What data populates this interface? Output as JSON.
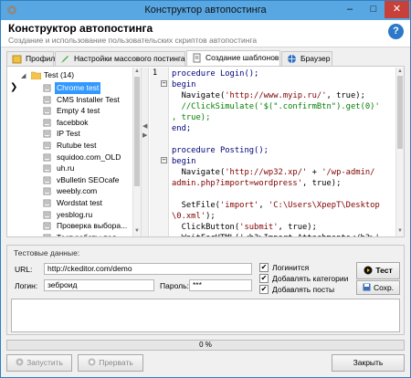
{
  "window": {
    "title": "Конструктор автопостинга"
  },
  "header": {
    "title": "Конструктор автопостинга",
    "subtitle": "Создание и использование пользовательских скриптов автопостинга"
  },
  "tabs": [
    {
      "label": "Профили",
      "icon": "profiles-icon"
    },
    {
      "label": "Настройки массового постинга",
      "icon": "pencil-icon"
    },
    {
      "label": "Создание шаблонов",
      "icon": "document-icon"
    },
    {
      "label": "Браузер",
      "icon": "browser-icon"
    }
  ],
  "tree": {
    "root": "Test (14)",
    "items": [
      "Chrome test",
      "CMS Installer Test",
      "Empty 4 test",
      "facebbok",
      "IP Test",
      "Rutube test",
      "squidoo.com_OLD",
      "uh.ru",
      "vBulletin SEOcafe",
      "weebly.com",
      "Wordstat test",
      "yesblog.ru",
      "Проверка выбора...",
      "Тест работы под..."
    ],
    "selected": "Chrome test"
  },
  "editor": {
    "line_numbers": [
      "1",
      "",
      "",
      "",
      "",
      "",
      "",
      "",
      "",
      "",
      "",
      "",
      "",
      "",
      ""
    ],
    "lines": [
      [
        {
          "t": "procedure Login();",
          "c": "kw"
        }
      ],
      [
        {
          "t": "begin",
          "c": "kw"
        }
      ],
      [
        {
          "t": "  Navigate(",
          "c": ""
        },
        {
          "t": "'http://www.myip.ru/'",
          "c": "str"
        },
        {
          "t": ", true);",
          "c": ""
        }
      ],
      [
        {
          "t": "  //ClickSimulate('$(\".confirmBtn\").get(0)'",
          "c": "cm"
        }
      ],
      [
        {
          "t": ", true);",
          "c": "cm"
        }
      ],
      [
        {
          "t": "end;",
          "c": "kw"
        }
      ],
      [
        {
          "t": "",
          "c": ""
        }
      ],
      [
        {
          "t": "procedure Posting();",
          "c": "kw"
        }
      ],
      [
        {
          "t": "begin",
          "c": "kw"
        }
      ],
      [
        {
          "t": "  Navigate(",
          "c": ""
        },
        {
          "t": "'http://wp32.xp/'",
          "c": "str"
        },
        {
          "t": " + ",
          "c": ""
        },
        {
          "t": "'/wp-admin/",
          "c": "str"
        }
      ],
      [
        {
          "t": "admin.php?import=wordpress'",
          "c": "str"
        },
        {
          "t": ", true);",
          "c": ""
        }
      ],
      [
        {
          "t": "",
          "c": ""
        }
      ],
      [
        {
          "t": "  SetFile(",
          "c": ""
        },
        {
          "t": "'import'",
          "c": "str"
        },
        {
          "t": ", ",
          "c": ""
        },
        {
          "t": "'C:\\Users\\XpepT\\Desktop",
          "c": "str"
        }
      ],
      [
        {
          "t": "\\0.xml'",
          "c": "str"
        },
        {
          "t": ");",
          "c": ""
        }
      ],
      [
        {
          "t": "  ClickButton(",
          "c": ""
        },
        {
          "t": "'submit'",
          "c": "str"
        },
        {
          "t": ", true);",
          "c": ""
        }
      ],
      [
        {
          "t": "  WaitForHTML('<h3>Import Attachments</h3>'",
          "c": ""
        }
      ]
    ]
  },
  "testdata": {
    "title": "Тестовые данные:",
    "url_label": "URL:",
    "url_value": "http://ckeditor.com/demo",
    "login_label": "Логин:",
    "login_value": "зеброид",
    "password_label": "Пароль:",
    "password_value": "***",
    "checks": [
      {
        "label": "Логинится",
        "checked": true
      },
      {
        "label": "Добавлять категории",
        "checked": true
      },
      {
        "label": "Добавлять посты",
        "checked": true
      }
    ],
    "test_button": "Тест",
    "save_button": "Сохр."
  },
  "progress": {
    "text": "0 %",
    "value": 0
  },
  "footer": {
    "start": "Запустить",
    "stop": "Прервать",
    "close": "Закрыть"
  }
}
